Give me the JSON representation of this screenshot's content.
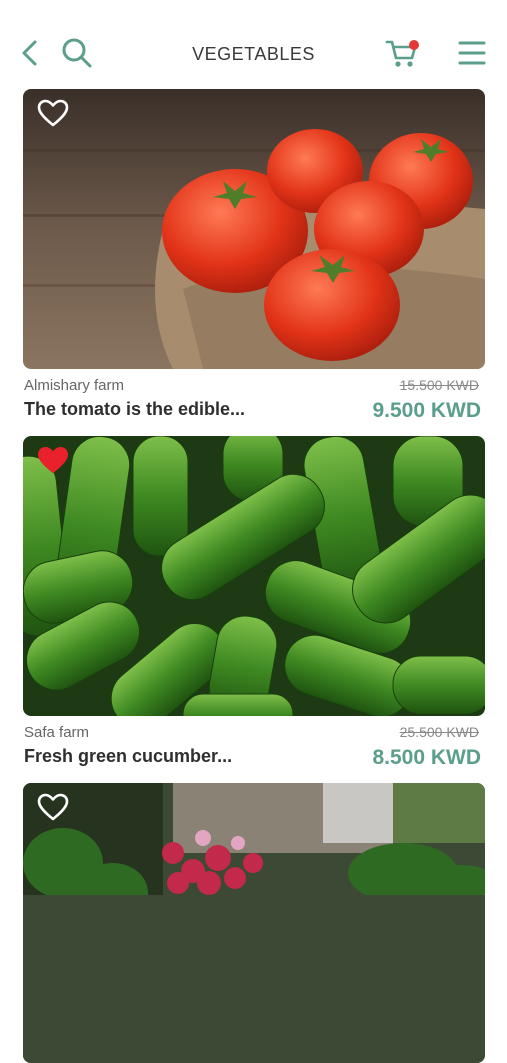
{
  "header": {
    "title": "VEGETABLES",
    "icons": [
      "back-icon",
      "search-icon",
      "cart-icon",
      "menu-icon"
    ],
    "accent_color": "#5b9e8c",
    "cart_badge_color": "#e53935"
  },
  "products": [
    {
      "farm": "Almishary farm",
      "name": "The tomato is the edible...",
      "old_price": "15.500 KWD",
      "price": "9.500 KWD",
      "favorite": false,
      "image": "tomatoes"
    },
    {
      "farm": "Safa farm",
      "name": "Fresh green cucumber...",
      "old_price": "25.500 KWD",
      "price": "8.500 KWD",
      "favorite": true,
      "image": "cucumbers"
    },
    {
      "favorite": false,
      "image": "radishes"
    }
  ]
}
